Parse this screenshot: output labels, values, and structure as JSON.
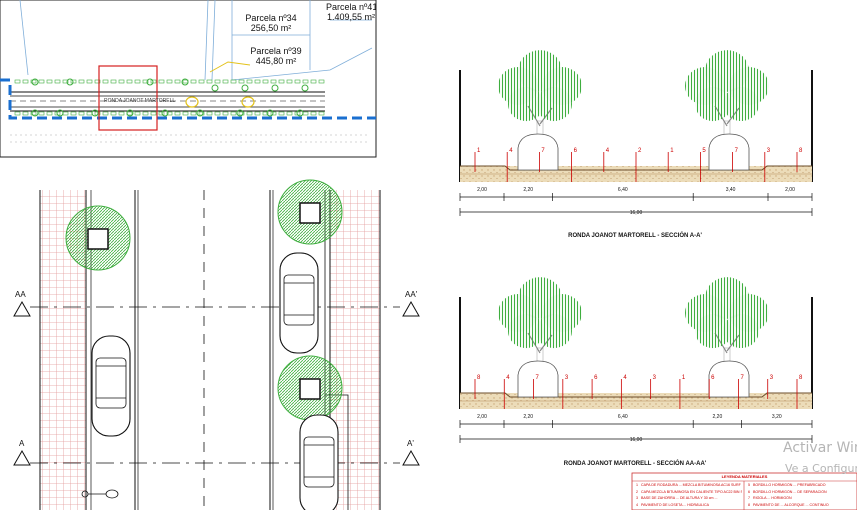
{
  "site_plan": {
    "parcel_34": {
      "name": "Parcela nº34",
      "area": "256,50 m²"
    },
    "parcel_39": {
      "name": "Parcela nº39",
      "area": "445,80 m²"
    },
    "parcel_41": {
      "name": "Parcela nº41",
      "area": "1.409,55 m²"
    },
    "street_name": "RONDA JOANOT MARTORELL"
  },
  "plan_view": {
    "section_marks": [
      "AA",
      "AA'",
      "A",
      "A'"
    ]
  },
  "section_aa1": {
    "title": "RONDA JOANOT MARTORELL - SECCIÓN A-A'",
    "dimensions": [
      "2,00",
      "2,20",
      "6,40",
      "3,40",
      "2,00"
    ],
    "total": "16,00",
    "callouts": [
      "1",
      "4",
      "7",
      "6",
      "4",
      "2",
      "1",
      "5",
      "7",
      "3",
      "8"
    ]
  },
  "section_aa2": {
    "title": "RONDA JOANOT MARTORELL - SECCIÓN AA-AA'",
    "dimensions": [
      "2,00",
      "2,20",
      "6,40",
      "2,20",
      "3,20"
    ],
    "total": "16,00",
    "callouts": [
      "8",
      "4",
      "7",
      "3",
      "6",
      "4",
      "3",
      "1",
      "6",
      "7",
      "3",
      "8"
    ]
  },
  "legend": {
    "title": "LEYENDA MATERIALES",
    "items": [
      {
        "num": "1",
        "text": "CAPA DE RODADURA ... MEZCLA BITUMINOSA AC16 SURF S"
      },
      {
        "num": "2",
        "text": "CAPA MEZCLA BITUMINOSA EN CALIENTE TIPO AC22 BIN S"
      },
      {
        "num": "3",
        "text": "BASE DE ZAHORRA ... DE ALTURA Y 30 cm ..."
      },
      {
        "num": "4",
        "text": "PAVIMENTO DE LOSETA ... HIDRÁULICA"
      },
      {
        "num": "5",
        "text": "BORDILLO HORMIGÓN ... PREFABRICADO"
      },
      {
        "num": "6",
        "text": "BORDILLO HORMIGÓN ... DE SEPARACIÓN"
      },
      {
        "num": "7",
        "text": "RIGOLA ... HORMIGÓN"
      },
      {
        "num": "8",
        "text": "PAVIMENTO DE ... ALCORQUE ... CONTINUO"
      }
    ]
  },
  "watermark": {
    "line1": "Activar Windows",
    "line2": "Ve a Configuración"
  },
  "colors": {
    "grid_red": "#e8a0a0",
    "tree_green": "#3fae3f",
    "callout_red": "#cc0000",
    "blue_dash": "#1a6fd0",
    "ground": "#e8d9b8"
  }
}
